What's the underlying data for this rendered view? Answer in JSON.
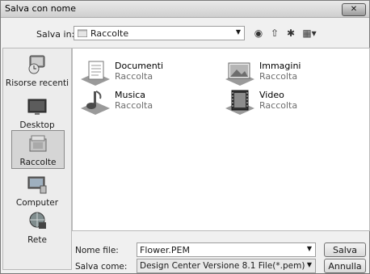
{
  "window": {
    "title": "Salva con nome",
    "close_glyph": "✕"
  },
  "save_in": {
    "label": "Salva in:",
    "value": "Raccolte"
  },
  "toolbar": {
    "back": "◉",
    "up": "⇧",
    "new_folder": "✱",
    "view": "▦▾"
  },
  "places": [
    {
      "label": "Risorse recenti",
      "icon": "recent-icon"
    },
    {
      "label": "Desktop",
      "icon": "desktop-icon"
    },
    {
      "label": "Raccolte",
      "icon": "libraries-icon"
    },
    {
      "label": "Computer",
      "icon": "computer-icon"
    },
    {
      "label": "Rete",
      "icon": "network-icon"
    }
  ],
  "items": [
    {
      "name": "Documenti",
      "sub": "Raccolta",
      "icon": "documents-library-icon"
    },
    {
      "name": "Immagini",
      "sub": "Raccolta",
      "icon": "pictures-library-icon"
    },
    {
      "name": "Musica",
      "sub": "Raccolta",
      "icon": "music-library-icon"
    },
    {
      "name": "Video",
      "sub": "Raccolta",
      "icon": "video-library-icon"
    }
  ],
  "filename": {
    "label": "Nome file:",
    "value": "Flower.PEM"
  },
  "filetype": {
    "label": "Salva come:",
    "value": "Design Center Versione 8.1 File(*.pem)"
  },
  "buttons": {
    "save": "Salva",
    "cancel": "Annulla"
  },
  "dropdown_arrow": "▼"
}
